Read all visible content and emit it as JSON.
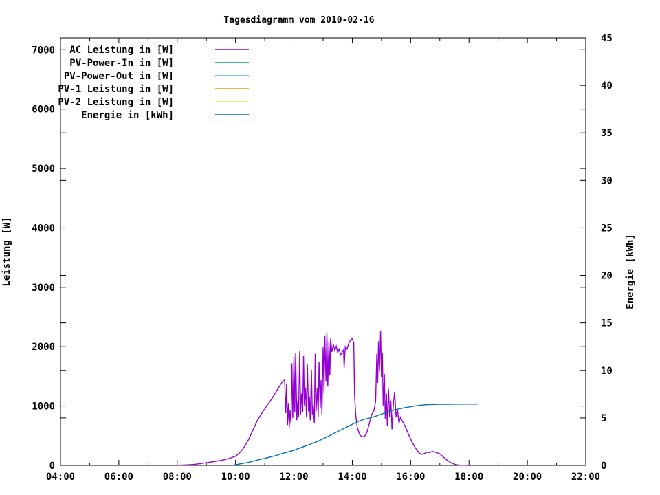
{
  "title": "Tagesdiagramm vom 2010-02-16",
  "legend": [
    {
      "label": "AC Leistung in [W]",
      "color": "#9400d3"
    },
    {
      "label": "PV-Power-In in [W]",
      "color": "#009e73"
    },
    {
      "label": "PV-Power-Out in [W]",
      "color": "#56b4e9"
    },
    {
      "label": "PV-1 Leistung in [W]",
      "color": "#e69f00"
    },
    {
      "label": "PV-2 Leistung in [W]",
      "color": "#f0e442"
    },
    {
      "label": "Energie in [kWh]",
      "color": "#0072b2"
    }
  ],
  "chart_data": {
    "type": "line",
    "title": "Tagesdiagramm vom 2010-02-16",
    "grid": false,
    "legend_position": "top-left-inside",
    "axes": {
      "x": {
        "unit": "time-of-day",
        "min": 4,
        "max": 22,
        "major": [
          4,
          6,
          8,
          10,
          12,
          14,
          16,
          18,
          20,
          22
        ],
        "labels": [
          "04:00",
          "06:00",
          "08:00",
          "10:00",
          "12:00",
          "14:00",
          "16:00",
          "18:00",
          "20:00",
          "22:00"
        ],
        "minor": [
          5,
          7,
          9,
          11,
          13,
          15,
          17,
          19,
          21
        ]
      },
      "y_left": {
        "title": "Leistung [W]",
        "min": 0,
        "max": 7200,
        "ticks": [
          0,
          1000,
          2000,
          3000,
          4000,
          5000,
          6000,
          7000
        ],
        "labels": [
          "0",
          "1000",
          "2000",
          "3000",
          "4000",
          "5000",
          "6000",
          "7000"
        ]
      },
      "y_right": {
        "title": "Energie [kWh]",
        "min": 0,
        "max": 45,
        "ticks": [
          0,
          5,
          10,
          15,
          20,
          25,
          30,
          35,
          40,
          45
        ],
        "labels": [
          "0",
          "5",
          "10",
          "15",
          "20",
          "25",
          "30",
          "35",
          "40",
          "45"
        ]
      }
    },
    "series": [
      {
        "name": "AC Leistung in [W]",
        "axis": "left",
        "color": "#9400d3",
        "points": [
          [
            8.05,
            3
          ],
          [
            8.2,
            6
          ],
          [
            8.4,
            10
          ],
          [
            8.6,
            18
          ],
          [
            8.8,
            30
          ],
          [
            9.0,
            45
          ],
          [
            9.2,
            60
          ],
          [
            9.4,
            75
          ],
          [
            9.6,
            95
          ],
          [
            9.8,
            120
          ],
          [
            10.0,
            155
          ],
          [
            10.15,
            215
          ],
          [
            10.3,
            310
          ],
          [
            10.45,
            440
          ],
          [
            10.6,
            600
          ],
          [
            10.75,
            760
          ],
          [
            10.9,
            880
          ],
          [
            11.05,
            990
          ],
          [
            11.2,
            1090
          ],
          [
            11.35,
            1210
          ],
          [
            11.5,
            1330
          ],
          [
            11.62,
            1420
          ],
          [
            11.68,
            1450
          ],
          [
            11.72,
            880
          ],
          [
            11.75,
            1380
          ],
          [
            11.78,
            680
          ],
          [
            11.81,
            1050
          ],
          [
            11.84,
            640
          ],
          [
            11.87,
            930
          ],
          [
            11.9,
            700
          ],
          [
            11.93,
            1720
          ],
          [
            11.96,
            800
          ],
          [
            12.0,
            1840
          ],
          [
            12.03,
            900
          ],
          [
            12.06,
            1890
          ],
          [
            12.1,
            760
          ],
          [
            12.13,
            1090
          ],
          [
            12.16,
            820
          ],
          [
            12.2,
            1930
          ],
          [
            12.23,
            860
          ],
          [
            12.26,
            1210
          ],
          [
            12.3,
            900
          ],
          [
            12.33,
            1840
          ],
          [
            12.36,
            1010
          ],
          [
            12.4,
            1300
          ],
          [
            12.43,
            810
          ],
          [
            12.46,
            1700
          ],
          [
            12.5,
            910
          ],
          [
            12.53,
            1160
          ],
          [
            12.56,
            760
          ],
          [
            12.6,
            1610
          ],
          [
            12.63,
            860
          ],
          [
            12.66,
            1010
          ],
          [
            12.7,
            710
          ],
          [
            12.73,
            1880
          ],
          [
            12.76,
            910
          ],
          [
            12.8,
            1310
          ],
          [
            12.83,
            820
          ],
          [
            12.86,
            1740
          ],
          [
            12.9,
            960
          ],
          [
            12.93,
            1440
          ],
          [
            12.96,
            860
          ],
          [
            13.0,
            1990
          ],
          [
            13.03,
            1210
          ],
          [
            13.06,
            2190
          ],
          [
            13.1,
            1420
          ],
          [
            13.13,
            2240
          ],
          [
            13.16,
            1330
          ],
          [
            13.2,
            2090
          ],
          [
            13.23,
            1520
          ],
          [
            13.26,
            2140
          ],
          [
            13.3,
            1910
          ],
          [
            13.35,
            2040
          ],
          [
            13.4,
            1940
          ],
          [
            13.45,
            2010
          ],
          [
            13.5,
            1900
          ],
          [
            13.55,
            1960
          ],
          [
            13.6,
            1860
          ],
          [
            13.65,
            1900
          ],
          [
            13.7,
            1950
          ],
          [
            13.72,
            1650
          ],
          [
            13.76,
            2000
          ],
          [
            13.82,
            1960
          ],
          [
            13.88,
            2060
          ],
          [
            13.94,
            2110
          ],
          [
            14.0,
            2140
          ],
          [
            14.05,
            2060
          ],
          [
            14.08,
            1180
          ],
          [
            14.12,
            840
          ],
          [
            14.17,
            640
          ],
          [
            14.25,
            520
          ],
          [
            14.33,
            480
          ],
          [
            14.42,
            490
          ],
          [
            14.5,
            555
          ],
          [
            14.58,
            700
          ],
          [
            14.66,
            850
          ],
          [
            14.74,
            920
          ],
          [
            14.8,
            1080
          ],
          [
            14.84,
            1880
          ],
          [
            14.87,
            1390
          ],
          [
            14.9,
            2090
          ],
          [
            14.93,
            1580
          ],
          [
            14.97,
            2270
          ],
          [
            15.0,
            1490
          ],
          [
            15.03,
            1890
          ],
          [
            15.06,
            1010
          ],
          [
            15.1,
            1540
          ],
          [
            15.13,
            790
          ],
          [
            15.17,
            1210
          ],
          [
            15.2,
            660
          ],
          [
            15.24,
            1290
          ],
          [
            15.28,
            810
          ],
          [
            15.32,
            1090
          ],
          [
            15.36,
            610
          ],
          [
            15.4,
            990
          ],
          [
            15.45,
            1240
          ],
          [
            15.5,
            820
          ],
          [
            15.55,
            940
          ],
          [
            15.6,
            710
          ],
          [
            15.65,
            810
          ],
          [
            15.7,
            760
          ],
          [
            15.78,
            690
          ],
          [
            15.86,
            600
          ],
          [
            15.95,
            500
          ],
          [
            16.04,
            400
          ],
          [
            16.12,
            330
          ],
          [
            16.2,
            270
          ],
          [
            16.29,
            210
          ],
          [
            16.38,
            185
          ],
          [
            16.47,
            200
          ],
          [
            16.56,
            225
          ],
          [
            16.65,
            215
          ],
          [
            16.74,
            235
          ],
          [
            16.83,
            225
          ],
          [
            16.92,
            210
          ],
          [
            17.0,
            195
          ],
          [
            17.08,
            160
          ],
          [
            17.17,
            120
          ],
          [
            17.26,
            85
          ],
          [
            17.35,
            55
          ],
          [
            17.44,
            32
          ],
          [
            17.53,
            16
          ],
          [
            17.63,
            7
          ],
          [
            17.75,
            3
          ],
          [
            17.9,
            1
          ],
          [
            18.05,
            0
          ]
        ]
      },
      {
        "name": "PV-Power-In in [W]",
        "axis": "left",
        "color": "#009e73",
        "points": []
      },
      {
        "name": "PV-Power-Out in [W]",
        "axis": "left",
        "color": "#56b4e9",
        "points": []
      },
      {
        "name": "PV-1 Leistung in [W]",
        "axis": "left",
        "color": "#e69f00",
        "points": []
      },
      {
        "name": "PV-2 Leistung in [W]",
        "axis": "left",
        "color": "#f0e442",
        "points": []
      },
      {
        "name": "Energie in [kWh]",
        "axis": "right",
        "color": "#0072b2",
        "points": [
          [
            9.9,
            0.0
          ],
          [
            10.0,
            0.08
          ],
          [
            10.2,
            0.18
          ],
          [
            10.4,
            0.3
          ],
          [
            10.6,
            0.44
          ],
          [
            10.8,
            0.6
          ],
          [
            11.0,
            0.74
          ],
          [
            11.2,
            0.9
          ],
          [
            11.4,
            1.05
          ],
          [
            11.6,
            1.25
          ],
          [
            11.8,
            1.42
          ],
          [
            12.0,
            1.6
          ],
          [
            12.2,
            1.82
          ],
          [
            12.4,
            2.05
          ],
          [
            12.6,
            2.28
          ],
          [
            12.8,
            2.52
          ],
          [
            13.0,
            2.8
          ],
          [
            13.2,
            3.1
          ],
          [
            13.4,
            3.42
          ],
          [
            13.6,
            3.72
          ],
          [
            13.8,
            4.02
          ],
          [
            14.0,
            4.32
          ],
          [
            14.2,
            4.62
          ],
          [
            14.4,
            4.85
          ],
          [
            14.6,
            5.0
          ],
          [
            14.8,
            5.18
          ],
          [
            15.0,
            5.4
          ],
          [
            15.2,
            5.62
          ],
          [
            15.4,
            5.82
          ],
          [
            15.6,
            5.95
          ],
          [
            15.8,
            6.08
          ],
          [
            16.0,
            6.18
          ],
          [
            16.2,
            6.28
          ],
          [
            16.4,
            6.35
          ],
          [
            16.6,
            6.4
          ],
          [
            16.8,
            6.42
          ],
          [
            17.0,
            6.43
          ],
          [
            17.3,
            6.44
          ],
          [
            17.7,
            6.45
          ],
          [
            18.1,
            6.45
          ],
          [
            18.3,
            6.45
          ]
        ]
      }
    ]
  }
}
